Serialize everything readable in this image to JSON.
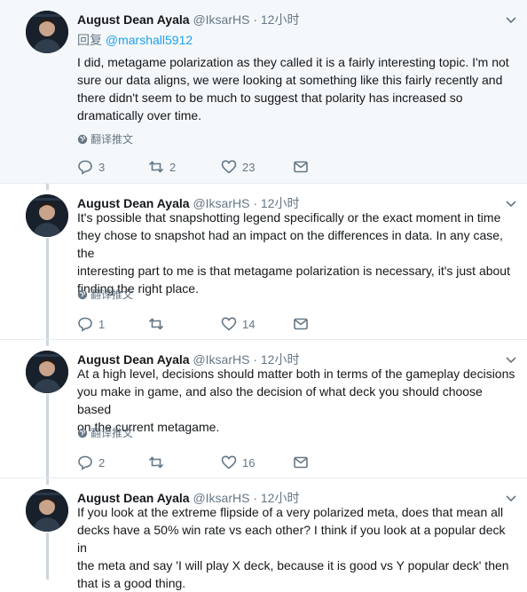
{
  "author": {
    "name": "August Dean Ayala",
    "handle": "@IksarHS"
  },
  "time": "12小时",
  "translate_label": "翻译推文",
  "reply_prefix": "回复",
  "tweets": [
    {
      "reply_to": "@marshall5912",
      "lines": [
        "I did, metagame polarization as they called it is a fairly interesting topic. I'm not",
        "sure our data aligns, we were looking at something like this fairly recently and",
        "there didn't seem to be much to suggest that polarity has increased so",
        "dramatically over time."
      ],
      "replies": "3",
      "retweets": "2",
      "likes": "23"
    },
    {
      "lines": [
        "It's possible that snapshotting legend specifically or the exact moment in time",
        "they chose to snapshot had an impact on the differences in data. In any case, the",
        "interesting part to me is that metagame polarization is necessary, it's just about",
        "finding the right place."
      ],
      "replies": "1",
      "retweets": "",
      "likes": "14"
    },
    {
      "lines": [
        "At a high level, decisions should matter both in terms of the gameplay decisions",
        "you make in game, and also the decision of what deck you should choose based",
        "on the current metagame."
      ],
      "replies": "2",
      "retweets": "",
      "likes": "16"
    },
    {
      "lines": [
        "If you look at the extreme flipside of a very polarized meta, does that mean all",
        "decks have a 50% win rate vs each other? I think if you look at a popular deck in",
        "the meta and say 'I will play X deck, because it is good vs Y popular deck' then",
        "that is a good thing."
      ]
    }
  ]
}
